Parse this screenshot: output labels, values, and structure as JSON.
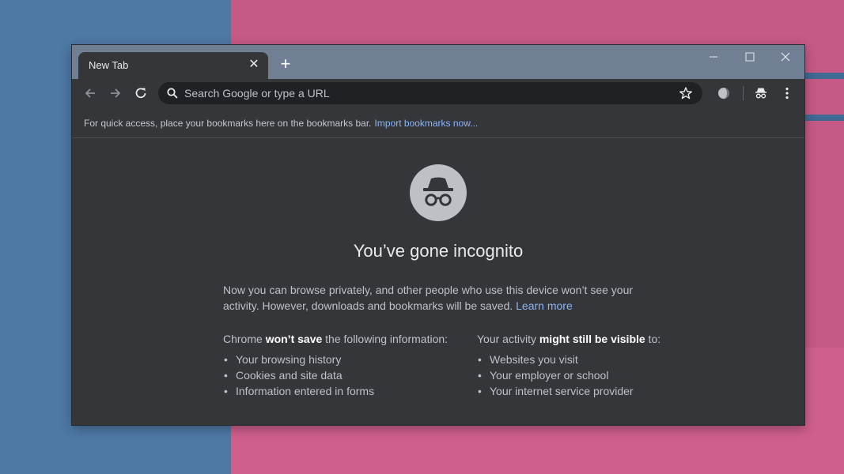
{
  "browser": {
    "tab": {
      "title": "New Tab",
      "close_glyph": "✕"
    },
    "new_tab_glyph": "+",
    "omnibox": {
      "placeholder": "Search Google or type a URL"
    },
    "bookmarks_bar": {
      "message": "For quick access, place your bookmarks here on the bookmarks bar.",
      "link": "Import bookmarks now..."
    }
  },
  "incognito": {
    "headline": "You’ve gone incognito",
    "intro": "Now you can browse privately, and other people who use this device won’t see your activity. However, downloads and bookmarks will be saved.",
    "learn_more": "Learn more",
    "left_column": {
      "head_prefix": "Chrome ",
      "head_bold": "won’t save",
      "head_suffix": " the following information:",
      "items": [
        "Your browsing history",
        "Cookies and site data",
        "Information entered in forms"
      ]
    },
    "right_column": {
      "head_prefix": "Your activity ",
      "head_bold": "might still be visible",
      "head_suffix": " to:",
      "items": [
        "Websites you visit",
        "Your employer or school",
        "Your internet service provider"
      ]
    }
  },
  "icons": [
    "back-arrow-icon",
    "forward-arrow-icon",
    "reload-icon",
    "search-icon",
    "star-icon",
    "extension-icon",
    "incognito-icon",
    "menu-icon",
    "minimize-icon",
    "maximize-icon",
    "close-icon"
  ],
  "colors": {
    "frame": "#707f94",
    "surface": "#35363a",
    "omnibox": "#202124",
    "link": "#8ab4f8"
  }
}
